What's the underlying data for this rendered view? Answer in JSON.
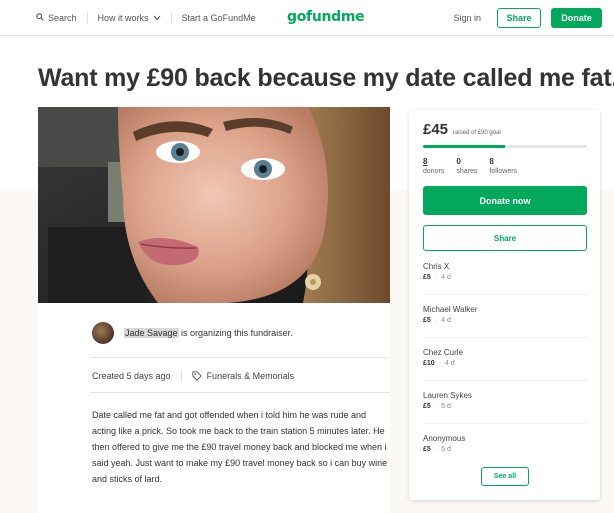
{
  "nav": {
    "search_label": "Search",
    "how_it_works_label": "How it works",
    "start_label": "Start a GoFundMe",
    "logo_text": "gofundme",
    "signin_label": "Sign in",
    "share_label": "Share",
    "donate_label": "Donate"
  },
  "campaign": {
    "title": "Want my £90 back because my date called me fat.",
    "organizer_name": "Jade Savage",
    "organizer_suffix": " is organizing this fundraiser.",
    "created": "Created 5 days ago",
    "category": "Funerals & Memorials",
    "story": "Date called me fat and got offended when i told him he was rude and acting like a prick. So took me back to the train station 5 minutes later. He then offered to give me the £90 travel money back and blocked me when i said yeah. Just want to make my £90 travel money back so i can buy wine and sticks of lard."
  },
  "sidebar": {
    "raised_amount": "£45",
    "raised_goal": "raised of £90 goal",
    "progress_fraction": 0.5,
    "donors_count": "8",
    "donors_label": "donors",
    "shares_count": "0",
    "shares_label": "shares",
    "followers_count": "8",
    "followers_label": "followers",
    "donate_now_label": "Donate now",
    "share_label": "Share",
    "see_all_label": "See all",
    "donations": [
      {
        "name": "Chris X",
        "amount": "£5",
        "time": "4 d"
      },
      {
        "name": "Michael Walker",
        "amount": "£5",
        "time": "4 d"
      },
      {
        "name": "Chez Curle",
        "amount": "£10",
        "time": "4 d"
      },
      {
        "name": "Lauren Sykes",
        "amount": "£5",
        "time": "5 d"
      },
      {
        "name": "Anonymous",
        "amount": "£5",
        "time": "5 d"
      }
    ]
  },
  "colors": {
    "brand_green": "#02a95c"
  }
}
